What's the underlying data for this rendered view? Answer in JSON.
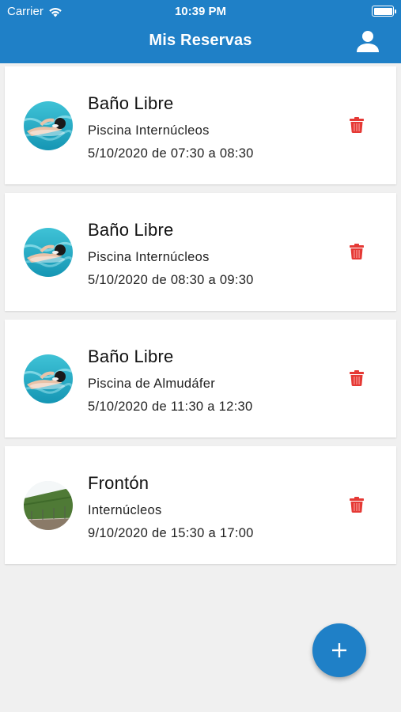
{
  "status_bar": {
    "carrier": "Carrier",
    "time": "10:39 PM"
  },
  "header": {
    "title": "Mis Reservas",
    "profile_icon": "user-icon"
  },
  "colors": {
    "primary": "#1f80c7",
    "delete": "#e53935",
    "background": "#f0f0f0"
  },
  "reservations": [
    {
      "title": "Baño Libre",
      "place": "Piscina Internúcleos",
      "time": "5/10/2020 de 07:30 a 08:30",
      "image": "swimmer"
    },
    {
      "title": "Baño Libre",
      "place": "Piscina Internúcleos",
      "time": "5/10/2020 de 08:30 a 09:30",
      "image": "swimmer"
    },
    {
      "title": "Baño Libre",
      "place": "Piscina de Almudáfer",
      "time": "5/10/2020 de 11:30 a 12:30",
      "image": "swimmer"
    },
    {
      "title": "Frontón",
      "place": "Internúcleos",
      "time": "9/10/2020 de 15:30 a 17:00",
      "image": "fronton-court"
    }
  ],
  "fab": {
    "icon": "plus-icon"
  }
}
